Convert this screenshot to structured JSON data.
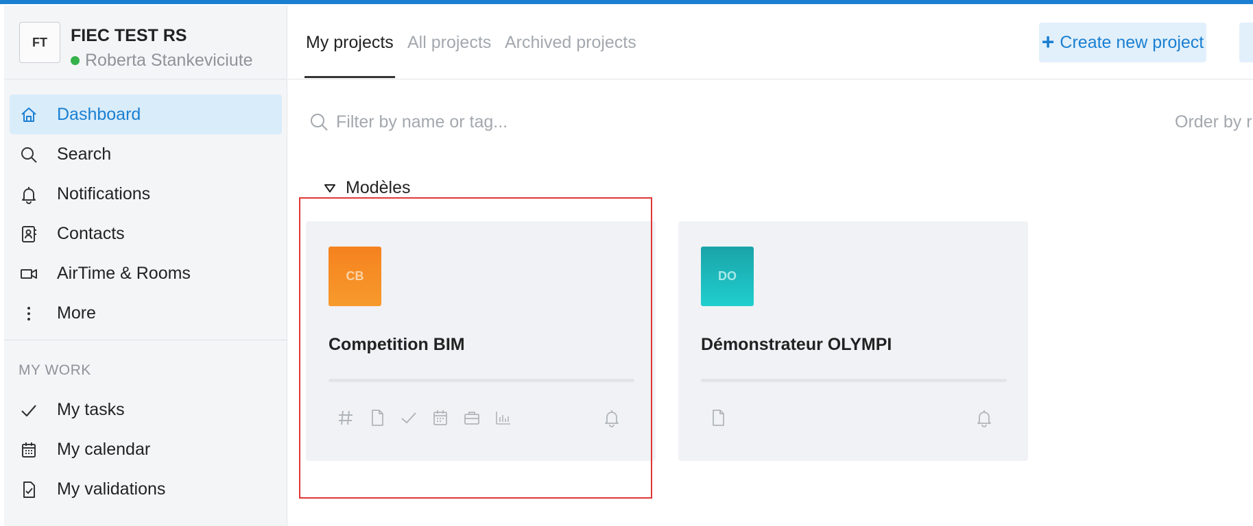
{
  "workspace": {
    "initials": "FT",
    "name": "FIEC TEST RS",
    "user": "Roberta Stankeviciute",
    "status_color": "#36b24a"
  },
  "nav": {
    "items": [
      {
        "label": "Dashboard",
        "icon": "home-icon",
        "active": true
      },
      {
        "label": "Search",
        "icon": "search-icon"
      },
      {
        "label": "Notifications",
        "icon": "bell-icon"
      },
      {
        "label": "Contacts",
        "icon": "contacts-icon"
      },
      {
        "label": "AirTime & Rooms",
        "icon": "video-icon"
      },
      {
        "label": "More",
        "icon": "more-vertical-icon"
      }
    ],
    "section_title": "MY WORK",
    "mywork": [
      {
        "label": "My tasks",
        "icon": "check-icon"
      },
      {
        "label": "My calendar",
        "icon": "calendar-icon"
      },
      {
        "label": "My validations",
        "icon": "validation-icon"
      }
    ]
  },
  "tabs": [
    {
      "label": "My projects",
      "active": true
    },
    {
      "label": "All projects"
    },
    {
      "label": "Archived projects"
    }
  ],
  "create_button": {
    "label": "Create new project"
  },
  "filter": {
    "placeholder": "Filter by name or tag..."
  },
  "order_by": "Order by r",
  "group": {
    "label": "Modèles"
  },
  "projects": [
    {
      "initials": "CB",
      "title": "Competition BIM",
      "color_from": "#f5821f",
      "color_to": "#f79a2c",
      "initials_color": "#fbd3a6",
      "icons": [
        "hash-icon",
        "document-icon",
        "check-icon",
        "calendar-icon",
        "briefcase-icon",
        "chart-icon"
      ]
    },
    {
      "initials": "DO",
      "title": "Démonstrateur OLYMPI",
      "color_from": "#1aa3a8",
      "color_to": "#20cfcf",
      "initials_color": "#a9e9e8",
      "icons": [
        "document-icon"
      ]
    }
  ],
  "colors": {
    "accent": "#1a7fd1",
    "highlight": "#e03535"
  }
}
